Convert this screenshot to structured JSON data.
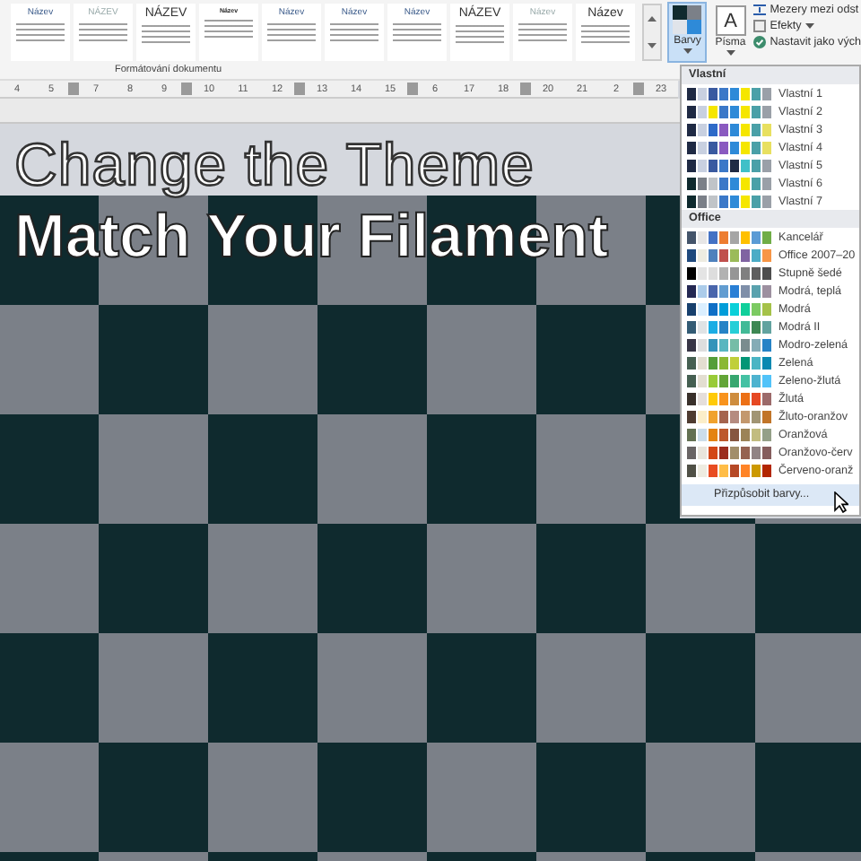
{
  "ribbon": {
    "style_gallery": [
      {
        "title": "Název",
        "kind": "small"
      },
      {
        "title": "NÁZEV",
        "kind": "faded"
      },
      {
        "title": "NÁZEV",
        "kind": "large"
      },
      {
        "title": "Název",
        "kind": "tiny"
      },
      {
        "title": "Název",
        "kind": "small"
      },
      {
        "title": "Název",
        "kind": "small"
      },
      {
        "title": "Název",
        "kind": "small"
      },
      {
        "title": "NÁZEV",
        "kind": "large"
      },
      {
        "title": "Název",
        "kind": "faded"
      },
      {
        "title": "Název",
        "kind": "large"
      }
    ],
    "group_label": "Formátování dokumentu",
    "theme_buttons": [
      {
        "label": "Barvy",
        "selected": true,
        "kind": "palette"
      },
      {
        "label": "Písma",
        "selected": false,
        "kind": "font",
        "icon_text": "A"
      }
    ],
    "options": [
      {
        "label": "Mezery mezi odst",
        "kind": "spacing"
      },
      {
        "label": "Efekty",
        "kind": "effects"
      },
      {
        "label": "Nastavit jako vých",
        "kind": "default"
      }
    ]
  },
  "ruler": [
    {
      "kind": "number",
      "label": "4"
    },
    {
      "kind": "number",
      "label": "5"
    },
    {
      "kind": "marker"
    },
    {
      "kind": "number",
      "label": "7"
    },
    {
      "kind": "number",
      "label": "8"
    },
    {
      "kind": "number",
      "label": "9"
    },
    {
      "kind": "marker"
    },
    {
      "kind": "number",
      "label": "10"
    },
    {
      "kind": "number",
      "label": "11"
    },
    {
      "kind": "number",
      "label": "12"
    },
    {
      "kind": "marker"
    },
    {
      "kind": "number",
      "label": "13"
    },
    {
      "kind": "number",
      "label": "14"
    },
    {
      "kind": "number",
      "label": "15"
    },
    {
      "kind": "marker"
    },
    {
      "kind": "number",
      "label": "6"
    },
    {
      "kind": "number",
      "label": "17"
    },
    {
      "kind": "number",
      "label": "18"
    },
    {
      "kind": "marker"
    },
    {
      "kind": "number",
      "label": "20"
    },
    {
      "kind": "number",
      "label": "21"
    },
    {
      "kind": "number",
      "label": "2"
    },
    {
      "kind": "marker"
    },
    {
      "kind": "number",
      "label": "23"
    }
  ],
  "overlay": {
    "headline": "Change the Theme",
    "subline": "Match Your Filament"
  },
  "colors_menu": {
    "sections": [
      {
        "header": "Vlastní",
        "items": [
          {
            "label": "Vlastní 1",
            "colors": [
              {
                "color": "#1f2a44"
              },
              {
                "color": "#c8d0e0"
              },
              {
                "color": "#3a5aa0"
              },
              {
                "color": "#3b78c8"
              },
              {
                "color": "#2e8ad8"
              },
              {
                "color": "#f5e600"
              },
              {
                "color": "#4aa0a8"
              },
              {
                "color": "#9aa0a8"
              }
            ]
          },
          {
            "label": "Vlastní 2",
            "colors": [
              {
                "color": "#1f2a44"
              },
              {
                "color": "#c8d0e0"
              },
              {
                "color": "#f5e600"
              },
              {
                "color": "#3b78c8"
              },
              {
                "color": "#2e8ad8"
              },
              {
                "color": "#f5e600"
              },
              {
                "color": "#4aa0a8"
              },
              {
                "color": "#9aa0a8"
              }
            ]
          },
          {
            "label": "Vlastní 3",
            "colors": [
              {
                "color": "#1f2a44"
              },
              {
                "color": "#c8d0e0"
              },
              {
                "color": "#2e6ac8"
              },
              {
                "color": "#8a5ac0"
              },
              {
                "color": "#2e8ad8"
              },
              {
                "color": "#f5e600"
              },
              {
                "color": "#4aa0a8"
              },
              {
                "color": "#e8e060"
              }
            ]
          },
          {
            "label": "Vlastní 4",
            "colors": [
              {
                "color": "#1f2a44"
              },
              {
                "color": "#c8d0e0"
              },
              {
                "color": "#3a5aa0"
              },
              {
                "color": "#8a5ac0"
              },
              {
                "color": "#2e8ad8"
              },
              {
                "color": "#f5e600"
              },
              {
                "color": "#4aa0a8"
              },
              {
                "color": "#e8e060"
              }
            ]
          },
          {
            "label": "Vlastní 5",
            "colors": [
              {
                "color": "#1f2a44"
              },
              {
                "color": "#c8d0e0"
              },
              {
                "color": "#3a5aa0"
              },
              {
                "color": "#3b78c8"
              },
              {
                "color": "#1f2a44"
              },
              {
                "color": "#40c0c8"
              },
              {
                "color": "#4aa0a8"
              },
              {
                "color": "#9aa0a8"
              }
            ]
          },
          {
            "label": "Vlastní 6",
            "colors": [
              {
                "color": "#0f2a2e"
              },
              {
                "color": "#7b8088"
              },
              {
                "color": "#c0c4c8"
              },
              {
                "color": "#3b78c8"
              },
              {
                "color": "#2e8ad8"
              },
              {
                "color": "#f5e600"
              },
              {
                "color": "#4aa0a8"
              },
              {
                "color": "#9aa0a8"
              }
            ]
          },
          {
            "label": "Vlastní 7",
            "colors": [
              {
                "color": "#0f2a2e"
              },
              {
                "color": "#7b8088"
              },
              {
                "color": "#c0c4c8"
              },
              {
                "color": "#3b78c8"
              },
              {
                "color": "#2e8ad8"
              },
              {
                "color": "#f5e600"
              },
              {
                "color": "#4aa0a8"
              },
              {
                "color": "#9aa0a8"
              }
            ]
          }
        ]
      },
      {
        "header": "Office",
        "items": [
          {
            "label": "Kancelář",
            "colors": [
              {
                "color": "#44546a"
              },
              {
                "color": "#e7e6e6"
              },
              {
                "color": "#4472c4"
              },
              {
                "color": "#ed7d31"
              },
              {
                "color": "#a5a5a5"
              },
              {
                "color": "#ffc000"
              },
              {
                "color": "#5b9bd5"
              },
              {
                "color": "#70ad47"
              }
            ]
          },
          {
            "label": "Office 2007–20",
            "colors": [
              {
                "color": "#1f497d"
              },
              {
                "color": "#eeece1"
              },
              {
                "color": "#4f81bd"
              },
              {
                "color": "#c0504d"
              },
              {
                "color": "#9bbb59"
              },
              {
                "color": "#8064a2"
              },
              {
                "color": "#4bacc6"
              },
              {
                "color": "#f79646"
              }
            ]
          },
          {
            "label": "Stupně šedé",
            "colors": [
              {
                "color": "#000000"
              },
              {
                "color": "#e4e4e4"
              },
              {
                "color": "#dddddd"
              },
              {
                "color": "#b2b2b2"
              },
              {
                "color": "#969696"
              },
              {
                "color": "#808080"
              },
              {
                "color": "#5f5f5f"
              },
              {
                "color": "#4d4d4d"
              }
            ]
          },
          {
            "label": "Modrá, teplá",
            "colors": [
              {
                "color": "#242852"
              },
              {
                "color": "#acccea"
              },
              {
                "color": "#4a66ac"
              },
              {
                "color": "#629dd1"
              },
              {
                "color": "#297fd5"
              },
              {
                "color": "#7f8fa9"
              },
              {
                "color": "#5aa2ae"
              },
              {
                "color": "#9d90a0"
              }
            ]
          },
          {
            "label": "Modrá",
            "colors": [
              {
                "color": "#17406d"
              },
              {
                "color": "#dbefff"
              },
              {
                "color": "#0f6fc6"
              },
              {
                "color": "#009dd9"
              },
              {
                "color": "#0bd0d9"
              },
              {
                "color": "#10cf9b"
              },
              {
                "color": "#7cca62"
              },
              {
                "color": "#a5c249"
              }
            ]
          },
          {
            "label": "Modrá II",
            "colors": [
              {
                "color": "#335b74"
              },
              {
                "color": "#dfe3e5"
              },
              {
                "color": "#1cade4"
              },
              {
                "color": "#2683c6"
              },
              {
                "color": "#27ced7"
              },
              {
                "color": "#42ba97"
              },
              {
                "color": "#3e8853"
              },
              {
                "color": "#62a39f"
              }
            ]
          },
          {
            "label": "Modro-zelená",
            "colors": [
              {
                "color": "#373545"
              },
              {
                "color": "#dedede"
              },
              {
                "color": "#3494ba"
              },
              {
                "color": "#58b6c0"
              },
              {
                "color": "#75bda7"
              },
              {
                "color": "#7a8c8e"
              },
              {
                "color": "#84acb6"
              },
              {
                "color": "#2683c6"
              }
            ]
          },
          {
            "label": "Zelená",
            "colors": [
              {
                "color": "#455f51"
              },
              {
                "color": "#e3ded1"
              },
              {
                "color": "#549e39"
              },
              {
                "color": "#8ab833"
              },
              {
                "color": "#c0cf3a"
              },
              {
                "color": "#029676"
              },
              {
                "color": "#4ab5c4"
              },
              {
                "color": "#0989b1"
              }
            ]
          },
          {
            "label": "Zeleno-žlutá",
            "colors": [
              {
                "color": "#455f51"
              },
              {
                "color": "#e3ded1"
              },
              {
                "color": "#99cb38"
              },
              {
                "color": "#63a537"
              },
              {
                "color": "#37a76f"
              },
              {
                "color": "#44c1a3"
              },
              {
                "color": "#4eb3cf"
              },
              {
                "color": "#51c3f9"
              }
            ]
          },
          {
            "label": "Žlutá",
            "colors": [
              {
                "color": "#39302a"
              },
              {
                "color": "#e5dedb"
              },
              {
                "color": "#ffca08"
              },
              {
                "color": "#f8931d"
              },
              {
                "color": "#ce8d3e"
              },
              {
                "color": "#ec7016"
              },
              {
                "color": "#e64823"
              },
              {
                "color": "#9c6a6a"
              }
            ]
          },
          {
            "label": "Žluto-oranžov",
            "colors": [
              {
                "color": "#4e3b30"
              },
              {
                "color": "#fbeec9"
              },
              {
                "color": "#f0a22e"
              },
              {
                "color": "#a5644e"
              },
              {
                "color": "#b58b80"
              },
              {
                "color": "#c3986d"
              },
              {
                "color": "#a19574"
              },
              {
                "color": "#c17529"
              }
            ]
          },
          {
            "label": "Oranžová",
            "colors": [
              {
                "color": "#637052"
              },
              {
                "color": "#ccddea"
              },
              {
                "color": "#e48312"
              },
              {
                "color": "#bd582c"
              },
              {
                "color": "#865640"
              },
              {
                "color": "#9b8357"
              },
              {
                "color": "#c2bc80"
              },
              {
                "color": "#94a088"
              }
            ]
          },
          {
            "label": "Oranžovo-červ",
            "colors": [
              {
                "color": "#696464"
              },
              {
                "color": "#e9e5dc"
              },
              {
                "color": "#d34817"
              },
              {
                "color": "#9b2d1f"
              },
              {
                "color": "#a28e6a"
              },
              {
                "color": "#956251"
              },
              {
                "color": "#918485"
              },
              {
                "color": "#855d5d"
              }
            ]
          },
          {
            "label": "Červeno-oranž",
            "colors": [
              {
                "color": "#505046"
              },
              {
                "color": "#eeece1"
              },
              {
                "color": "#e84c22"
              },
              {
                "color": "#ffbd47"
              },
              {
                "color": "#b64926"
              },
              {
                "color": "#ff8427"
              },
              {
                "color": "#cc9900"
              },
              {
                "color": "#b22600"
              }
            ]
          }
        ]
      }
    ],
    "footer": "Přizpůsobit barvy..."
  }
}
